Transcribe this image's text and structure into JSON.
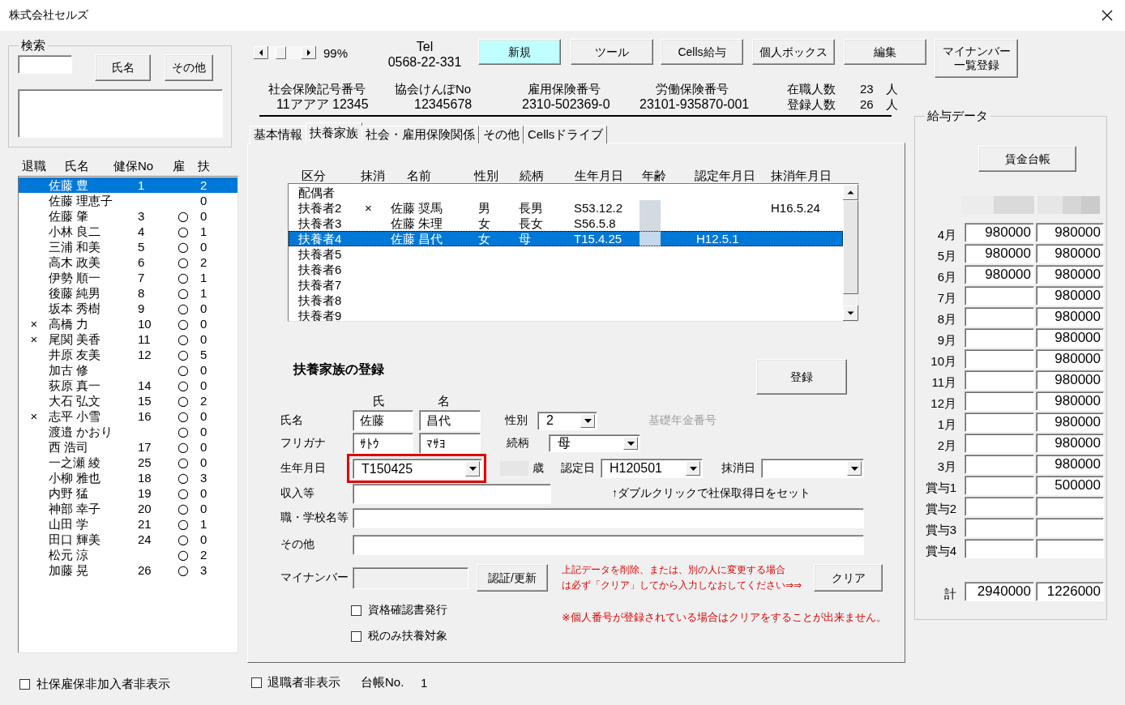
{
  "window": {
    "title": "株式会社セルズ"
  },
  "search": {
    "title": "検索",
    "buttons": [
      "氏名",
      "その他"
    ]
  },
  "employee_list": {
    "columns": [
      "退職",
      "氏名",
      "健保No",
      "雇",
      "扶"
    ],
    "rows": [
      {
        "name": "佐藤 豊",
        "health_no": "1",
        "dependents": "2",
        "selected": true
      },
      {
        "name": "佐藤 理恵子",
        "dependents": "0",
        "selected": false
      },
      {
        "name": "佐藤 肇",
        "health_no": "3",
        "employment": "○",
        "dependents": "0",
        "selected": false
      },
      {
        "name": "小林 良二",
        "health_no": "4",
        "employment": "○",
        "dependents": "1",
        "selected": false
      },
      {
        "name": "三浦 和美",
        "health_no": "5",
        "employment": "○",
        "dependents": "0",
        "selected": false
      },
      {
        "name": "高木 政美",
        "health_no": "6",
        "employment": "○",
        "dependents": "2",
        "selected": false
      },
      {
        "name": "伊勢 順一",
        "health_no": "7",
        "employment": "○",
        "dependents": "1",
        "selected": false
      },
      {
        "name": "後藤 純男",
        "health_no": "8",
        "employment": "○",
        "dependents": "1",
        "selected": false
      },
      {
        "name": "坂本 秀樹",
        "health_no": "9",
        "employment": "○",
        "dependents": "0",
        "selected": false
      },
      {
        "retired": "×",
        "name": "高橋 力",
        "health_no": "10",
        "employment": "○",
        "dependents": "0",
        "selected": false
      },
      {
        "retired": "×",
        "name": "尾関 美香",
        "health_no": "11",
        "employment": "○",
        "dependents": "0",
        "selected": false
      },
      {
        "name": "井原 友美",
        "health_no": "12",
        "employment": "○",
        "dependents": "5",
        "selected": false
      },
      {
        "name": "加古 修",
        "employment": "○",
        "dependents": "0",
        "selected": false
      },
      {
        "name": "荻原 真一",
        "health_no": "14",
        "employment": "○",
        "dependents": "0",
        "selected": false
      },
      {
        "name": "大石 弘文",
        "health_no": "15",
        "employment": "○",
        "dependents": "2",
        "selected": false
      },
      {
        "retired": "×",
        "name": "志平 小雪",
        "health_no": "16",
        "employment": "○",
        "dependents": "0",
        "selected": false
      },
      {
        "name": "渡邉 かおり",
        "employment": "○",
        "dependents": "0",
        "selected": false
      },
      {
        "name": "西 浩司",
        "health_no": "17",
        "employment": "○",
        "dependents": "0",
        "selected": false
      },
      {
        "name": "一之瀬 綾",
        "health_no": "25",
        "employment": "○",
        "dependents": "0",
        "selected": false
      },
      {
        "name": "小柳 雅也",
        "health_no": "18",
        "employment": "○",
        "dependents": "3",
        "selected": false
      },
      {
        "name": "内野 猛",
        "health_no": "19",
        "employment": "○",
        "dependents": "0",
        "selected": false
      },
      {
        "name": "神部 幸子",
        "health_no": "20",
        "employment": "○",
        "dependents": "0",
        "selected": false
      },
      {
        "name": "山田 学",
        "health_no": "21",
        "employment": "○",
        "dependents": "1",
        "selected": false
      },
      {
        "name": "田口 輝美",
        "health_no": "24",
        "employment": "○",
        "dependents": "0",
        "selected": false
      },
      {
        "name": "松元 涼",
        "employment": "○",
        "dependents": "2",
        "selected": false
      },
      {
        "name": "加藤 晃",
        "health_no": "26",
        "employment": "○",
        "dependents": "3",
        "selected": false
      }
    ]
  },
  "hide_uninsured": {
    "label": "社保雇保非加入者非表示",
    "checked": false
  },
  "zoom": "99%",
  "tel": {
    "label": "Tel",
    "number": "0568-22-331"
  },
  "toolbar": [
    {
      "label": "新規",
      "highlighted": true
    },
    {
      "label": "ツール",
      "highlighted": false
    },
    {
      "label": "Cells給与",
      "highlighted": false
    },
    {
      "label": "個人ボックス",
      "highlighted": false
    },
    {
      "label": "編集",
      "highlighted": false
    },
    {
      "label": "マイナンバー一覧登録",
      "highlighted": false
    }
  ],
  "insurance_numbers": [
    {
      "label": "社会保険記号番号",
      "value": "11アアア 12345"
    },
    {
      "label": "協会けんぽNo",
      "value": "12345678"
    },
    {
      "label": "雇用保険番号",
      "value": "2310-502369-0"
    },
    {
      "label": "労働保険番号",
      "value": "23101-935870-001"
    }
  ],
  "headcounts": [
    {
      "label": "在職人数",
      "value": "23",
      "unit": "人"
    },
    {
      "label": "登録人数",
      "value": "26",
      "unit": "人"
    }
  ],
  "tabs": [
    {
      "label": "基本情報",
      "selected": false
    },
    {
      "label": "扶養家族",
      "selected": true
    },
    {
      "label": "社会・雇用保険関係",
      "selected": false
    },
    {
      "label": "その他",
      "selected": false
    },
    {
      "label": "Cellsドライブ",
      "selected": false
    }
  ],
  "dependents_list": {
    "columns": [
      "区分",
      "抹消",
      "名前",
      "性別",
      "続柄",
      "生年月日",
      "年齢",
      "認定年月日",
      "抹消年月日"
    ],
    "rows": [
      {
        "category": "配偶者",
        "selected": false
      },
      {
        "category": "扶養者2",
        "deleted": "×",
        "name": "佐藤 奨馬",
        "sex": "男",
        "relation": "長男",
        "birth_date": "S53.12.2",
        "age_blurred": true,
        "deletion_date": "H16.5.24",
        "selected": false
      },
      {
        "category": "扶養者3",
        "name": "佐藤 朱理",
        "sex": "女",
        "relation": "長女",
        "birth_date": "S56.5.8",
        "age_blurred": true,
        "selected": false
      },
      {
        "category": "扶養者4",
        "name": "佐藤 昌代",
        "sex": "女",
        "relation": "母",
        "birth_date": "T15.4.25",
        "age_blurred": true,
        "recognition_date": "H12.5.1",
        "selected": true
      },
      {
        "category": "扶養者5",
        "selected": false
      },
      {
        "category": "扶養者6",
        "selected": false
      },
      {
        "category": "扶養者7",
        "selected": false
      },
      {
        "category": "扶養者8",
        "selected": false
      },
      {
        "category": "扶養者9",
        "selected": false
      }
    ]
  },
  "form": {
    "title": "扶養家族の登録",
    "register_button": "登録",
    "name_headers": [
      "氏",
      "名"
    ],
    "name": {
      "label": "氏名",
      "values": [
        "佐藤",
        "昌代"
      ]
    },
    "sex": {
      "label": "性別",
      "value": "2"
    },
    "pension_no": {
      "label": "基礎年金番号",
      "disabled": true
    },
    "kana": {
      "label": "フリガナ",
      "values": [
        "ｻﾄｳ",
        "ﾏｻﾖ"
      ]
    },
    "relation": {
      "label": "続柄",
      "value": "母"
    },
    "birth_date": {
      "label": "生年月日",
      "value": "T150425",
      "highlighted": true
    },
    "age": {
      "unit": "歳",
      "blurred": true
    },
    "recognition_date": {
      "label": "認定日",
      "value": "H120501"
    },
    "deletion_date": {
      "label": "抹消日"
    },
    "income": {
      "label": "収入等"
    },
    "hint": "↑ダブルクリックで社保取得日をセット",
    "workplace": {
      "label": "職・学校名等"
    },
    "other": {
      "label": "その他"
    },
    "my_number": {
      "label": "マイナンバー",
      "disabled": true
    },
    "verify_button": "認証/更新",
    "warning_lines": [
      "上記データを削除、または、別の人に変更する場合",
      "は必ず「クリア」してから入力しなおしてください⇒⇒"
    ],
    "clear_button": "クリア",
    "options": [
      {
        "label": "資格確認書発行",
        "checked": false
      },
      {
        "label": "税のみ扶養対象",
        "checked": false
      }
    ],
    "note": "※個人番号が登録されている場合はクリアをすることが出来ません。"
  },
  "hide_retired": {
    "label": "退職者非表示",
    "checked": false
  },
  "ledger_no": {
    "label": "台帳No.",
    "value": "1"
  },
  "salary_data": {
    "title": "給与データ",
    "button": "賃金台帳",
    "header_blurred": true,
    "rows": [
      {
        "label": "4月",
        "column_1": "980000",
        "column_2": "980000"
      },
      {
        "label": "5月",
        "column_1": "980000",
        "column_2": "980000"
      },
      {
        "label": "6月",
        "column_1": "980000",
        "column_2": "980000"
      },
      {
        "label": "7月",
        "column_2": "980000"
      },
      {
        "label": "8月",
        "column_2": "980000"
      },
      {
        "label": "9月",
        "column_2": "980000"
      },
      {
        "label": "10月",
        "column_2": "980000"
      },
      {
        "label": "11月",
        "column_2": "980000"
      },
      {
        "label": "12月",
        "column_2": "980000"
      },
      {
        "label": "1月",
        "column_2": "980000"
      },
      {
        "label": "2月",
        "column_2": "980000"
      },
      {
        "label": "3月",
        "column_2": "980000"
      },
      {
        "label": "賞与1",
        "column_2": "500000"
      },
      {
        "label": "賞与2"
      },
      {
        "label": "賞与3"
      },
      {
        "label": "賞与4"
      }
    ],
    "total": {
      "label": "計",
      "column_1": "2940000",
      "column_2": "1226000"
    }
  }
}
